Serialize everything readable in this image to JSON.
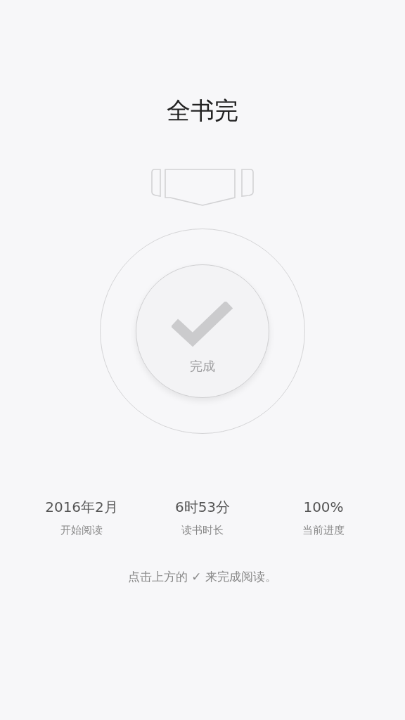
{
  "title": "全书完",
  "complete_button": {
    "label": "完成"
  },
  "stats": [
    {
      "value": "2016年2月",
      "label": "开始阅读"
    },
    {
      "value": "6时53分",
      "label": "读书时长"
    },
    {
      "value": "100%",
      "label": "当前进度"
    }
  ],
  "hint": "点击上方的 ✓ 来完成阅读。"
}
